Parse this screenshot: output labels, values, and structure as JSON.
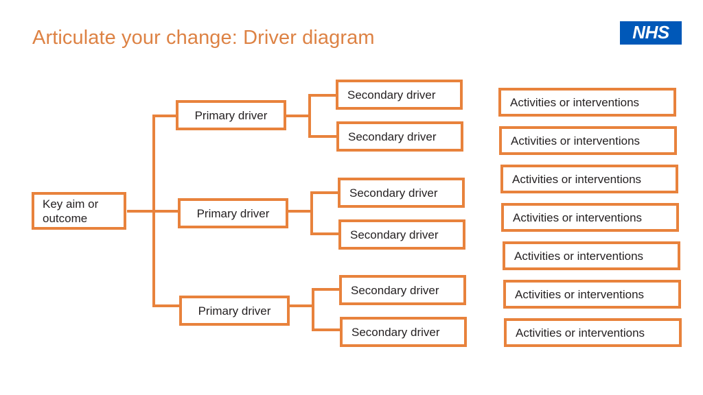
{
  "slide": {
    "title": "Articulate your change: Driver diagram",
    "logo": {
      "name": "NHS",
      "text": "NHS",
      "background_color": "#0058B8",
      "text_color": "#FFFFFF"
    },
    "colors": {
      "accent_orange": "#E8823C",
      "title_orange": "#DD8244",
      "text_black": "#231F20",
      "background": "#FFFFFF"
    }
  },
  "diagram": {
    "type": "driver-diagram",
    "key_aim": {
      "label": "Key aim or\noutcome",
      "line1": "Key aim or",
      "line2": "outcome"
    },
    "primary_drivers": [
      {
        "label": "Primary driver"
      },
      {
        "label": "Primary driver"
      },
      {
        "label": "Primary driver"
      }
    ],
    "secondary_drivers": [
      {
        "label": "Secondary driver"
      },
      {
        "label": "Secondary driver"
      },
      {
        "label": "Secondary driver"
      },
      {
        "label": "Secondary driver"
      },
      {
        "label": "Secondary driver"
      },
      {
        "label": "Secondary driver"
      }
    ],
    "activities": [
      {
        "label": "Activities or interventions"
      },
      {
        "label": "Activities or interventions"
      },
      {
        "label": "Activities or interventions"
      },
      {
        "label": "Activities or interventions"
      },
      {
        "label": "Activities or interventions"
      },
      {
        "label": "Activities or interventions"
      },
      {
        "label": "Activities or interventions"
      }
    ]
  }
}
